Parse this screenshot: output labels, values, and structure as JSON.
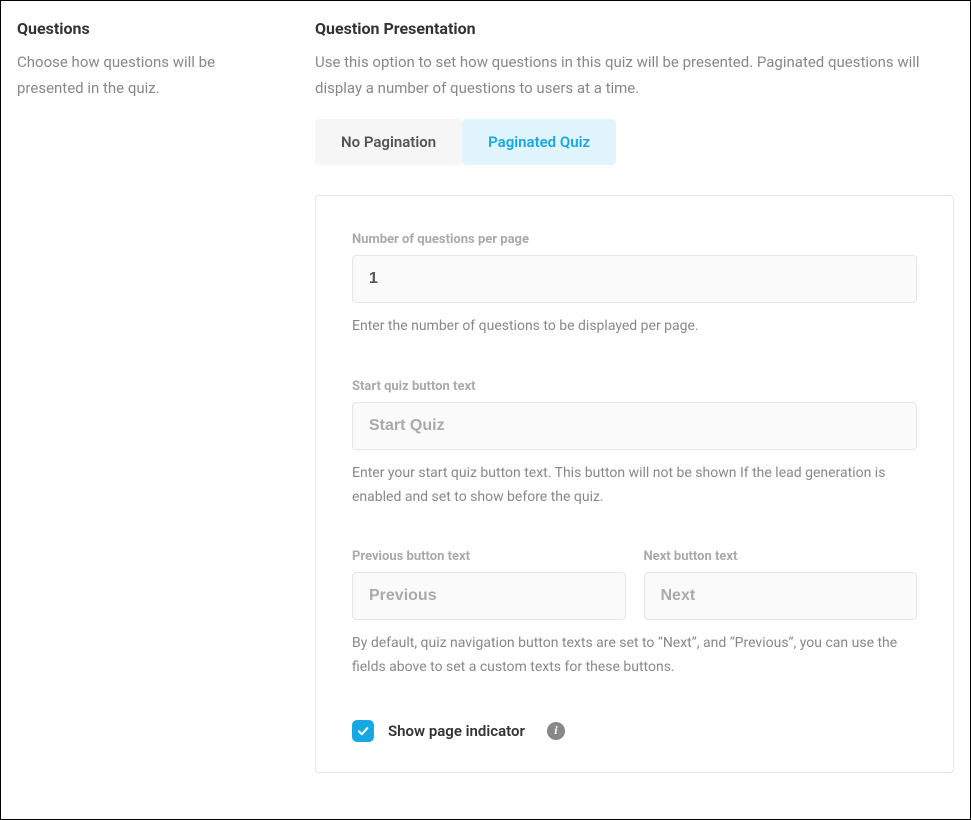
{
  "sidebar": {
    "title": "Questions",
    "description": "Choose how questions will be presented in the quiz."
  },
  "main": {
    "title": "Question Presentation",
    "description": "Use this option to set how questions in this quiz will be presented. Paginated questions will display a number of questions to users at a time.",
    "tabs": {
      "no_pagination": "No Pagination",
      "paginated": "Paginated Quiz"
    },
    "fields": {
      "per_page": {
        "label": "Number of questions per page",
        "value": "1",
        "help": "Enter the number of questions to be displayed per page."
      },
      "start_button": {
        "label": "Start quiz button text",
        "placeholder": "Start Quiz",
        "value": "",
        "help": "Enter your start quiz button text. This button will not be shown If the lead generation is enabled and set to show before the quiz."
      },
      "prev_button": {
        "label": "Previous button text",
        "placeholder": "Previous",
        "value": ""
      },
      "next_button": {
        "label": "Next button text",
        "placeholder": "Next",
        "value": ""
      },
      "nav_help": "By default, quiz navigation button texts are set to “Next”, and “Previous”, you can use the fields above to set a custom texts for these buttons.",
      "page_indicator": {
        "label": "Show page indicator",
        "checked": true
      }
    }
  }
}
